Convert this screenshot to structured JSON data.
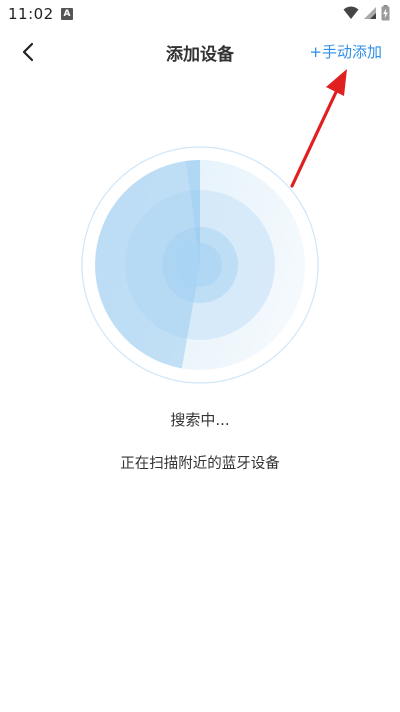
{
  "status_bar": {
    "time": "11:02",
    "notification_letter": "A",
    "icons": [
      "wifi-icon",
      "signal-icon",
      "battery-charging-icon"
    ]
  },
  "header": {
    "back_icon": "chevron-left-icon",
    "title": "添加设备",
    "manual_add_label": "+手动添加"
  },
  "scan": {
    "status": "搜索中...",
    "description": "正在扫描附近的蓝牙设备"
  },
  "colors": {
    "accent": "#2f8ee8",
    "radar_outer_ring": "#cfe6f8",
    "radar_light": "#e3f1fb",
    "radar_mid": "#c3e0f6",
    "radar_inner": "#a7d2f2",
    "annotation_arrow": "#e02020"
  }
}
